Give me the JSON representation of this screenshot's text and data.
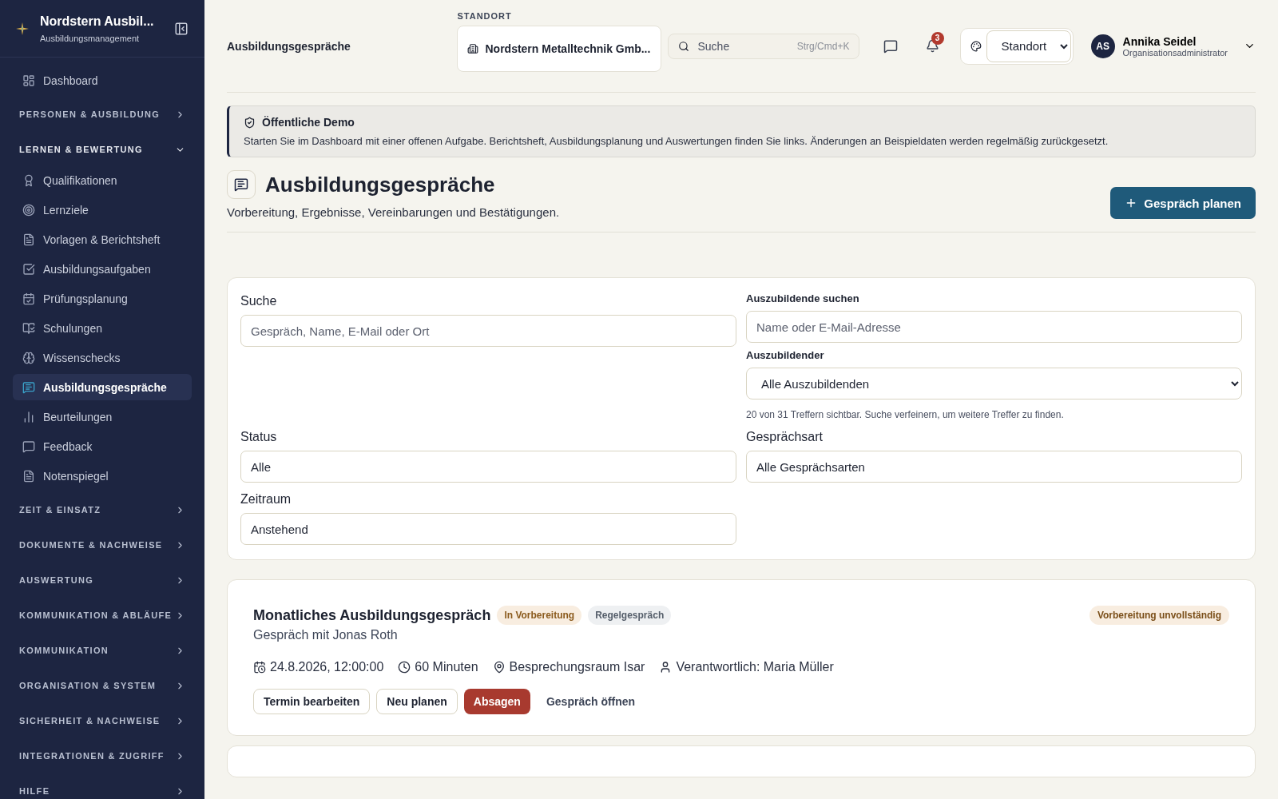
{
  "sidebar": {
    "brand": {
      "title": "Nordstern Ausbil...",
      "subtitle": "Ausbildungsmanagement"
    },
    "items": [
      {
        "kind": "link",
        "label": "Dashboard",
        "selected": false
      },
      {
        "kind": "section",
        "label": "PERSONEN & AUSBILDUNG",
        "expanded": false
      },
      {
        "kind": "section",
        "label": "LERNEN & BEWERTUNG",
        "expanded": true,
        "children": [
          {
            "label": "Qualifikationen",
            "selected": false
          },
          {
            "label": "Lernziele",
            "selected": false
          },
          {
            "label": "Vorlagen & Berichtsheft",
            "selected": false
          },
          {
            "label": "Ausbildungsaufgaben",
            "selected": false
          },
          {
            "label": "Prüfungsplanung",
            "selected": false
          },
          {
            "label": "Schulungen",
            "selected": false
          },
          {
            "label": "Wissenschecks",
            "selected": false
          },
          {
            "label": "Ausbildungsgespräche",
            "selected": true
          },
          {
            "label": "Beurteilungen",
            "selected": false
          },
          {
            "label": "Feedback",
            "selected": false
          },
          {
            "label": "Notenspiegel",
            "selected": false
          }
        ]
      },
      {
        "kind": "section",
        "label": "ZEIT & EINSATZ",
        "expanded": false
      },
      {
        "kind": "section",
        "label": "DOKUMENTE & NACHWEISE",
        "expanded": false
      },
      {
        "kind": "section",
        "label": "AUSWERTUNG",
        "expanded": false
      },
      {
        "kind": "section",
        "label": "KOMMUNIKATION & ABLÄUFE",
        "expanded": false
      },
      {
        "kind": "section",
        "label": "KOMMUNIKATION",
        "expanded": false
      },
      {
        "kind": "section",
        "label": "ORGANISATION & SYSTEM",
        "expanded": false
      },
      {
        "kind": "section",
        "label": "SICHERHEIT & NACHWEISE",
        "expanded": false
      },
      {
        "kind": "section",
        "label": "INTEGRATIONEN & ZUGRIFF",
        "expanded": false
      },
      {
        "kind": "section",
        "label": "HILFE",
        "expanded": false
      }
    ]
  },
  "header": {
    "page_title": "Ausbildungsgespräche",
    "location": {
      "label": "STANDORT",
      "value": "Nordstern Metalltechnik Gmb..."
    },
    "search": {
      "placeholder": "Suche",
      "shortcut": "Strg/Cmd+K"
    },
    "notifications": {
      "count": "3"
    },
    "view_select": {
      "value": "Standort"
    },
    "user": {
      "initials": "AS",
      "name": "Annika Seidel",
      "role": "Organisationsadministrator"
    }
  },
  "banner": {
    "title": "Öffentliche Demo",
    "text": "Starten Sie im Dashboard mit einer offenen Aufgabe. Berichtsheft, Ausbildungsplanung und Auswertungen finden Sie links. Änderungen an Beispieldaten werden regelmäßig zurückgesetzt."
  },
  "page": {
    "title": "Ausbildungsgespräche",
    "subtitle": "Vorbereitung, Ergebnisse, Vereinbarungen und Bestätigungen.",
    "primary_button": "Gespräch planen"
  },
  "filters": {
    "search": {
      "label": "Suche",
      "placeholder": "Gespräch, Name, E-Mail oder Ort"
    },
    "trainee_search": {
      "label": "Auszubildende suchen",
      "placeholder": "Name oder E-Mail-Adresse"
    },
    "trainee": {
      "label": "Auszubildender",
      "value": "Alle Auszubildenden"
    },
    "hint": "20 von 31 Treffern sichtbar. Suche verfeinern, um weitere Treffer zu finden.",
    "status": {
      "label": "Status",
      "value": "Alle"
    },
    "type": {
      "label": "Gesprächsart",
      "value": "Alle Gesprächsarten"
    },
    "period": {
      "label": "Zeitraum",
      "value": "Anstehend"
    }
  },
  "conversations": [
    {
      "title": "Monatliches Ausbildungsgespräch",
      "tags": [
        {
          "label": "In Vorbereitung",
          "kind": "status"
        },
        {
          "label": "Regelgespräch",
          "kind": "type"
        }
      ],
      "subtitle": "Gespräch mit Jonas Roth",
      "flag": "Vorbereitung unvollständig",
      "meta": [
        {
          "kind": "date",
          "text": "24.8.2026, 12:00:00"
        },
        {
          "kind": "duration",
          "text": "60 Minuten"
        },
        {
          "kind": "place",
          "text": "Besprechungsraum Isar"
        },
        {
          "kind": "person",
          "text": "Verantwortlich: Maria Müller"
        }
      ],
      "actions": [
        {
          "label": "Termin bearbeiten",
          "kind": "outline"
        },
        {
          "label": "Neu planen",
          "kind": "outline"
        },
        {
          "label": "Absagen",
          "kind": "danger"
        },
        {
          "label": "Gespräch öffnen",
          "kind": "link"
        }
      ]
    }
  ]
}
